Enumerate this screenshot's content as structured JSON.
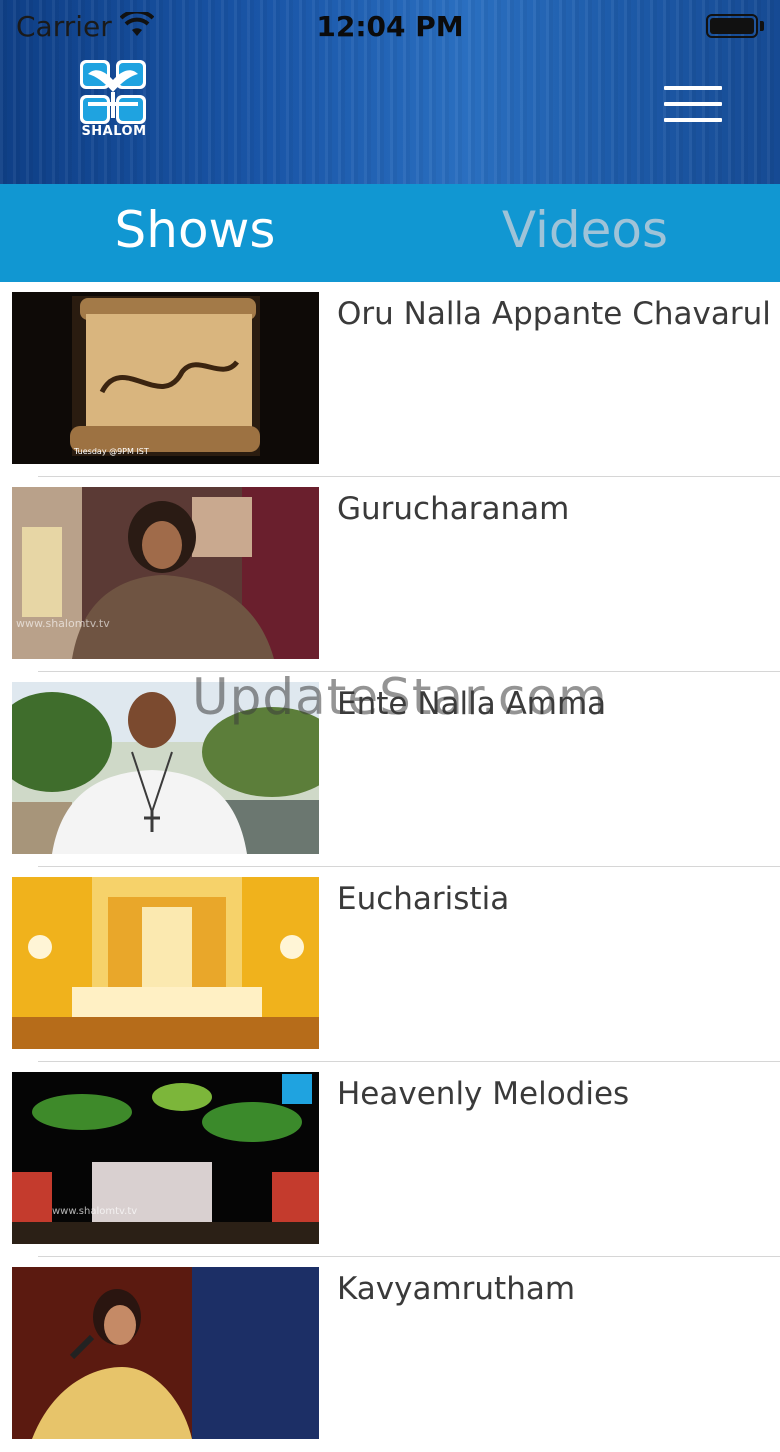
{
  "status": {
    "carrier": "Carrier",
    "time": "12:04 PM",
    "battery_level": 1.0
  },
  "header": {
    "logo_text": "SHALOM",
    "menu_icon": "hamburger-icon"
  },
  "tabs": [
    {
      "label": "Shows",
      "active": true
    },
    {
      "label": "Videos",
      "active": false
    }
  ],
  "shows": [
    {
      "title": "Oru Nalla Appante Chavarul",
      "thumb_caption": "Tuesday @9PM IST"
    },
    {
      "title": "Gurucharanam",
      "thumb_caption": "www.shalomtv.tv"
    },
    {
      "title": "Ente Nalla Amma",
      "thumb_caption": ""
    },
    {
      "title": "Eucharistia",
      "thumb_caption": ""
    },
    {
      "title": "Heavenly Melodies",
      "thumb_caption": "www.shalomtv.tv"
    },
    {
      "title": "Kavyamrutham",
      "thumb_caption": ""
    }
  ],
  "watermark": "UpdateStar.com",
  "colors": {
    "tab_bar": "#1197d2",
    "tab_active": "#ffffff",
    "tab_inactive": "#9fc3d8",
    "header_blue": "#1a56a8"
  }
}
